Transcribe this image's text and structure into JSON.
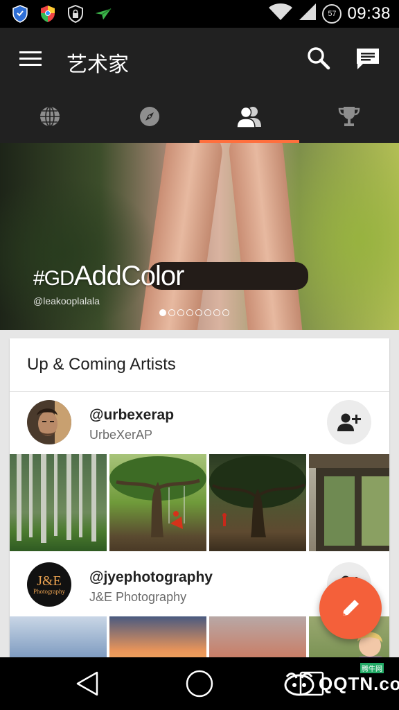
{
  "status_bar": {
    "time": "09:38",
    "battery": "57",
    "icons": [
      "shield-icon",
      "chrome-shield-icon",
      "lock-shield-icon",
      "paper-plane-icon",
      "wifi-icon",
      "signal-icon"
    ]
  },
  "app_bar": {
    "title": "艺术家",
    "icons": [
      "menu-icon",
      "search-icon",
      "chat-icon"
    ]
  },
  "tabs": [
    {
      "icon": "globe-icon",
      "active": false
    },
    {
      "icon": "compass-icon",
      "active": false
    },
    {
      "icon": "people-icon",
      "active": true
    },
    {
      "icon": "trophy-icon",
      "active": false
    }
  ],
  "banner": {
    "hashtag_prefix": "#GD",
    "hashtag_main": "AddColor",
    "credit": "@leakooplalala",
    "dots_total": 8,
    "dots_active_index": 0
  },
  "section": {
    "title": "Up & Coming Artists"
  },
  "artists": [
    {
      "handle": "@urbexerap",
      "name": "UrbeXerAP",
      "avatar_icon": "portrait-avatar"
    },
    {
      "handle": "@jyephotography",
      "name": "J&E Photography",
      "avatar_text": "J&E",
      "avatar_subtext": "Photography"
    }
  ],
  "fab": {
    "icon": "pencil-icon"
  },
  "nav": {
    "icons": [
      "back-icon",
      "home-icon",
      "recents-icon"
    ]
  },
  "watermark": {
    "text": "QQTN.com",
    "sub": "腾牛网"
  },
  "colors": {
    "accent": "#f4603a",
    "tab_indicator": "#ff6f3d",
    "app_bar": "#212121"
  }
}
